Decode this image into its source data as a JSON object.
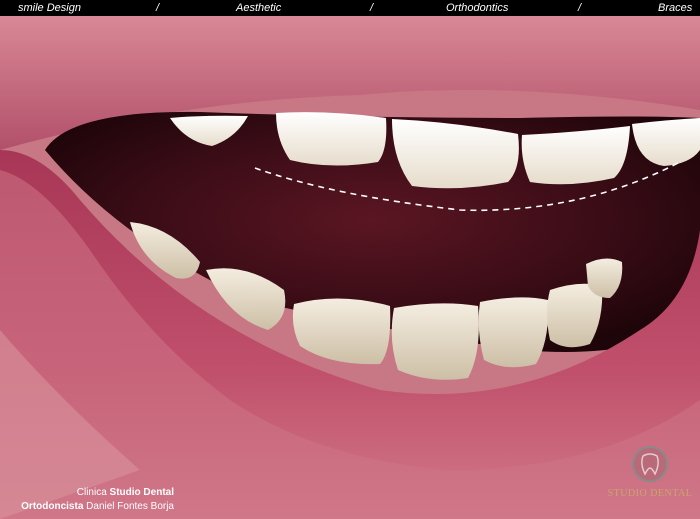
{
  "topbar": {
    "item1": "smile Design",
    "sep1": "/",
    "item2": "Aesthetic",
    "sep2": "/",
    "item3": "Orthodontics",
    "sep3": "/",
    "item4": "Braces"
  },
  "credits": {
    "clinic_prefix": "Clinica",
    "clinic_name": "Studio Dental",
    "role": "Ortodoncista",
    "doctor": "Daniel Fontes Borja"
  },
  "logo": {
    "icon": "tooth-logo-icon",
    "text": "STUDIO DENTAL"
  },
  "colors": {
    "topbar_bg": "#000000",
    "lip": "#b84a62",
    "mouth_interior": "#3a0c16",
    "tooth": "#f2eee6",
    "logo_gold": "#c9a56a"
  }
}
